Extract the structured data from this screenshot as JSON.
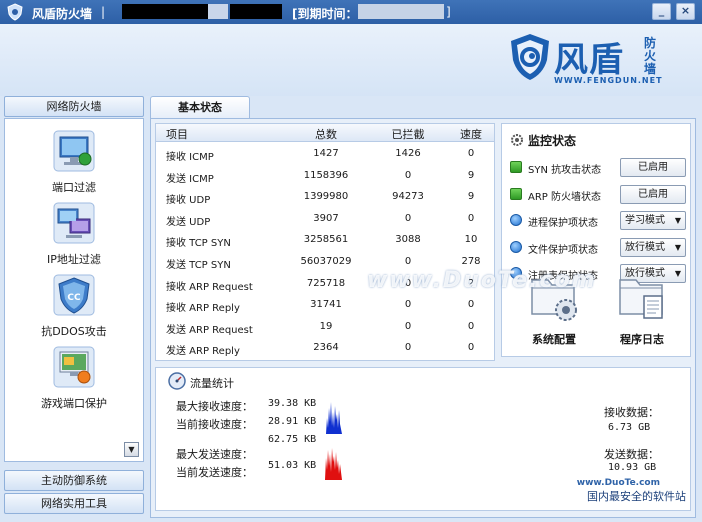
{
  "window": {
    "title": "风盾防火墙",
    "expiry_label": "[到期时间：",
    "expiry_close": "]",
    "minimize": "_",
    "close": "×"
  },
  "logo": {
    "name": "风盾",
    "sub": "防火墙",
    "url": "WWW.FENGDUN.NET"
  },
  "sidebar": {
    "top_header": "网络防火墙",
    "items": [
      {
        "label": "端口过滤",
        "icon": "monitor-icon"
      },
      {
        "label": "IP地址过滤",
        "icon": "network-icon"
      },
      {
        "label": "抗DDOS攻击",
        "icon": "shield-cc-icon"
      },
      {
        "label": "游戏端口保护",
        "icon": "game-monitor-icon"
      }
    ],
    "bottom_headers": [
      "主动防御系统",
      "网络实用工具"
    ]
  },
  "tabs": [
    {
      "label": "基本状态"
    }
  ],
  "stats": {
    "columns": [
      "项目",
      "总数",
      "已拦截",
      "速度"
    ],
    "rows": [
      {
        "name": "接收 ICMP",
        "total": "1427",
        "blocked": "1426",
        "speed": "0"
      },
      {
        "name": "发送 ICMP",
        "total": "1158396",
        "blocked": "0",
        "speed": "9"
      },
      {
        "name": "接收 UDP",
        "total": "1399980",
        "blocked": "94273",
        "speed": "9"
      },
      {
        "name": "发送 UDP",
        "total": "3907",
        "blocked": "0",
        "speed": "0"
      },
      {
        "name": "接收 TCP SYN",
        "total": "3258561",
        "blocked": "3088",
        "speed": "10"
      },
      {
        "name": "发送 TCP SYN",
        "total": "56037029",
        "blocked": "0",
        "speed": "278"
      },
      {
        "name": "接收 ARP Request",
        "total": "725718",
        "blocked": "0",
        "speed": "2"
      },
      {
        "name": "接收 ARP Reply",
        "total": "31741",
        "blocked": "0",
        "speed": "0"
      },
      {
        "name": "发送 ARP Request",
        "total": "19",
        "blocked": "0",
        "speed": "0"
      },
      {
        "name": "发送 ARP Reply",
        "total": "2364",
        "blocked": "0",
        "speed": "0"
      }
    ]
  },
  "monitor": {
    "title": "监控状态",
    "rows": [
      {
        "label": "SYN 抗攻击状态",
        "value": "已启用",
        "type": "button",
        "indicator": "green"
      },
      {
        "label": "ARP 防火墙状态",
        "value": "已启用",
        "type": "button",
        "indicator": "green"
      },
      {
        "label": "进程保护项状态",
        "value": "学习模式",
        "type": "select",
        "indicator": "blue"
      },
      {
        "label": "文件保护项状态",
        "value": "放行模式",
        "type": "select",
        "indicator": "blue"
      },
      {
        "label": "注册表保护状态",
        "value": "放行模式",
        "type": "select",
        "indicator": "blue"
      }
    ],
    "system_config": "系统配置",
    "program_log": "程序日志"
  },
  "traffic": {
    "title": "流量统计",
    "max_recv_label": "最大接收速度：",
    "max_recv": "39.38 KB",
    "cur_recv_label": "当前接收速度：",
    "cur_recv": "28.91 KB",
    "max_send_label": "最大发送速度：",
    "max_send": "62.75 KB",
    "cur_send_label": "当前发送速度：",
    "cur_send": "51.03 KB",
    "recv_data_label": "接收数据：",
    "recv_data": "6.73 GB",
    "send_data_label": "发送数据：",
    "send_data": "10.93 GB",
    "recv_color": "#1030d0",
    "send_color": "#e01010"
  },
  "watermarks": {
    "center": "www.DuoTe.com",
    "corner_top": "www.DuoTe.com",
    "corner_bottom": "国内最安全的软件站"
  }
}
